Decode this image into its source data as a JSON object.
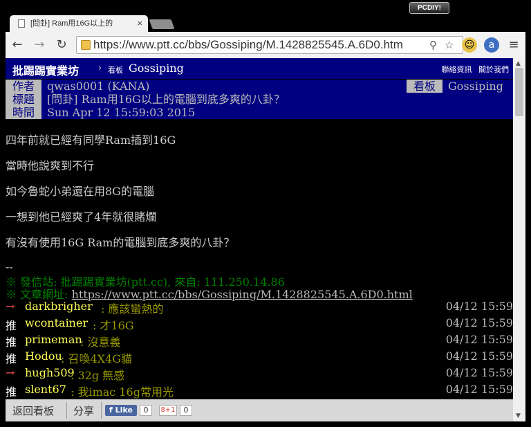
{
  "browser": {
    "badge": "PCDIY!",
    "tab_title": "[問卦] Ram用16G以上的",
    "tab_close": "×",
    "url": "https://www.ptt.cc/bbs/Gossiping/M.1428825545.A.6D0.htm"
  },
  "header": {
    "brand": "批踢踢實業坊",
    "separator": "›",
    "board_label": "看板",
    "board": "Gossiping",
    "link_contact": "聯絡資訊",
    "link_about": "關於我們"
  },
  "meta": {
    "author_tag": "作者",
    "author": "qwas0001 (KANA)",
    "board_tag": "看板",
    "board": "Gossiping",
    "title_tag": "標題",
    "title": "[問卦] Ram用16G以上的電腦到底多爽的八卦？",
    "time_tag": "時間",
    "time": "Sun Apr 12 15:59:03 2015"
  },
  "body": {
    "lines": [
      "四年前就已經有同學Ram插到16G",
      "當時他說爽到不行",
      "如今魯蛇小弟還在用8G的電腦",
      "一想到他已經爽了4年就很賭爛",
      "有沒有使用16G Ram的電腦到底多爽的八卦？"
    ],
    "sig_sep": "--",
    "sig_site": "※ 發信站: 批踢踢實業坊(ptt.cc), 來自: 111.250.14.86",
    "sig_url_label": "※ 文章網址: ",
    "sig_url": "https://www.ptt.cc/bbs/Gossiping/M.1428825545.A.6D0.html"
  },
  "pushes": [
    {
      "tag": "→",
      "user": "darkbrigher",
      "content": ": 應該蠻熱的",
      "time": "04/12 15:59"
    },
    {
      "tag": "推",
      "user": "wcontainer",
      "content": ": 才16G",
      "time": "04/12 15:59"
    },
    {
      "tag": "推",
      "user": "primeman",
      "content": ": 沒意義",
      "time": "04/12 15:59"
    },
    {
      "tag": "推",
      "user": "Hodou",
      "content": ": 召喚4X4G貓",
      "time": "04/12 15:59"
    },
    {
      "tag": "→",
      "user": "hugh509",
      "content": ": 32g  無感",
      "time": "04/12 15:59"
    },
    {
      "tag": "推",
      "user": "slent67",
      "content": ": 我imac 16g常用光",
      "time": "04/12 15:59"
    }
  ],
  "footer": {
    "back": "返回看板",
    "share": "分享",
    "fb_like": "Like",
    "fb_count": "0",
    "gplus": "8+1",
    "gplus_count": "0"
  },
  "colors": {
    "header_bg": "#000080",
    "tag_bg": "#bbbbbb",
    "push_user": "#ffff55",
    "push_content": "#999900",
    "sig_green": "#008000",
    "push_arrow": "#ff5555"
  }
}
